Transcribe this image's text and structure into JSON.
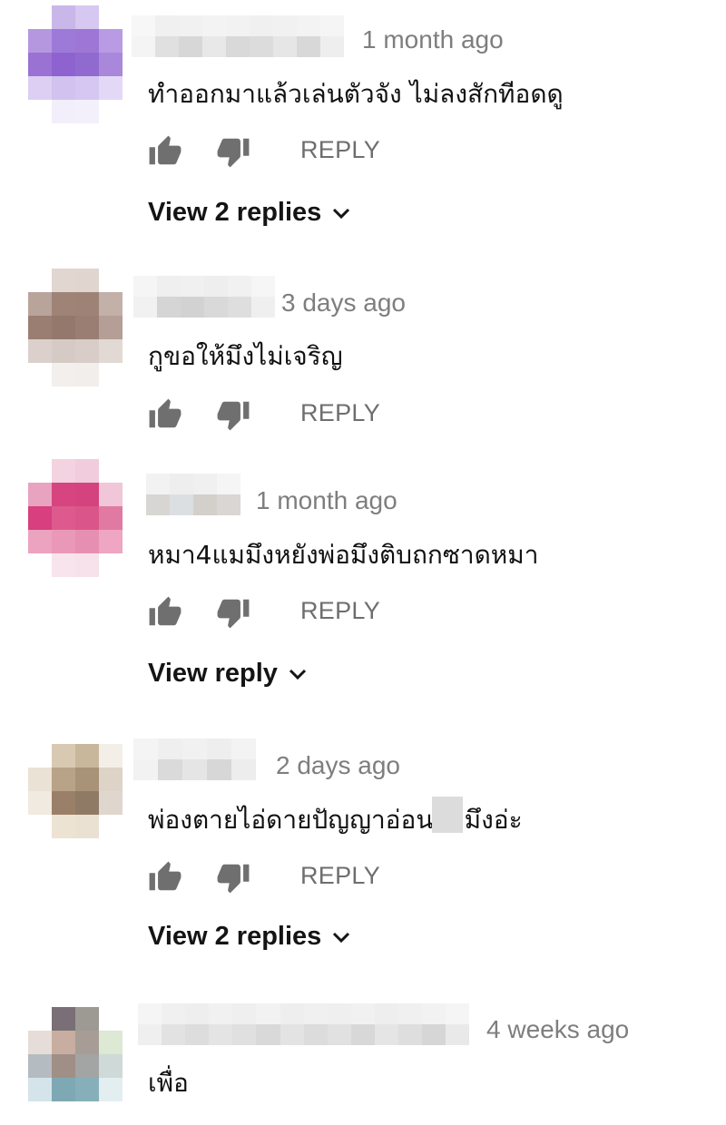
{
  "comments": [
    {
      "time": "1 month ago",
      "text": "ทำออกมาแล้วเล่นตัวจัง ไม่ลงสักทีอดดู",
      "reply_label": "REPLY",
      "view_replies": "View 2 replies"
    },
    {
      "time": "3 days ago",
      "text": "กูขอให้มึงไม่เจริญ",
      "reply_label": "REPLY",
      "view_replies": ""
    },
    {
      "time": "1 month ago",
      "text": "หมา4แมมึงหยังพ่อมึงติบถกซาดหมา",
      "reply_label": "REPLY",
      "view_replies": "View reply"
    },
    {
      "time": "2 days ago",
      "text_part1": "พ่องตายไอ่ด",
      "text_part2": "ายปัญญาอ่อนนะมึงอ่ะ",
      "reply_label": "REPLY",
      "view_replies": "View 2 replies"
    },
    {
      "time": "4 weeks ago",
      "text": "เพื่อ",
      "reply_label": "",
      "view_replies": ""
    }
  ],
  "icons": {
    "like": "thumbs-up-icon",
    "dislike": "thumbs-down-icon",
    "expand": "chevron-down-icon"
  },
  "colors": {
    "icon": "#6f6f6f",
    "meta": "#7e7e7e",
    "text": "#111111"
  }
}
